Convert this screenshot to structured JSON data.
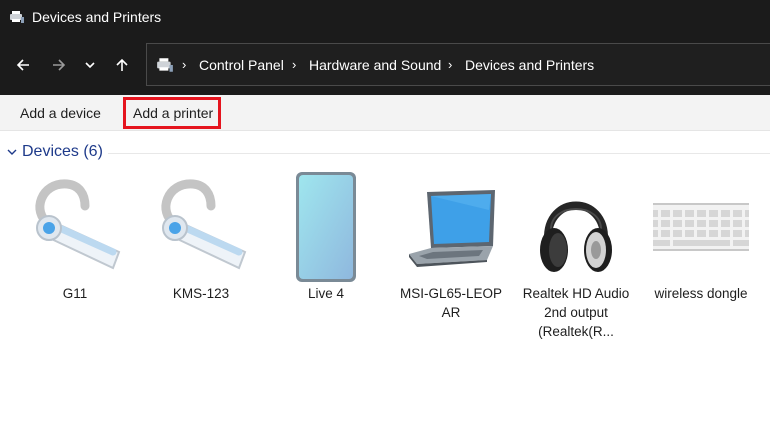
{
  "window": {
    "title": "Devices and Printers"
  },
  "breadcrumb": [
    "Control Panel",
    "Hardware and Sound",
    "Devices and Printers"
  ],
  "commands": {
    "add_device": "Add a device",
    "add_printer": "Add a printer"
  },
  "group": {
    "title": "Devices (6)"
  },
  "devices": [
    {
      "label": "G11",
      "icon": "headset-icon"
    },
    {
      "label": "KMS-123",
      "icon": "headset-icon"
    },
    {
      "label": "Live 4",
      "icon": "phone-icon"
    },
    {
      "label": "MSI-GL65-LEOP AR",
      "icon": "laptop-icon"
    },
    {
      "label": "Realtek HD Audio 2nd output (Realtek(R...",
      "icon": "headphones-icon"
    },
    {
      "label": "wireless dongle",
      "icon": "keyboard-icon"
    }
  ],
  "colors": {
    "titlebar": "#1b1b1b",
    "accent_group": "#1e3a8a",
    "highlight": "#e5141e"
  }
}
